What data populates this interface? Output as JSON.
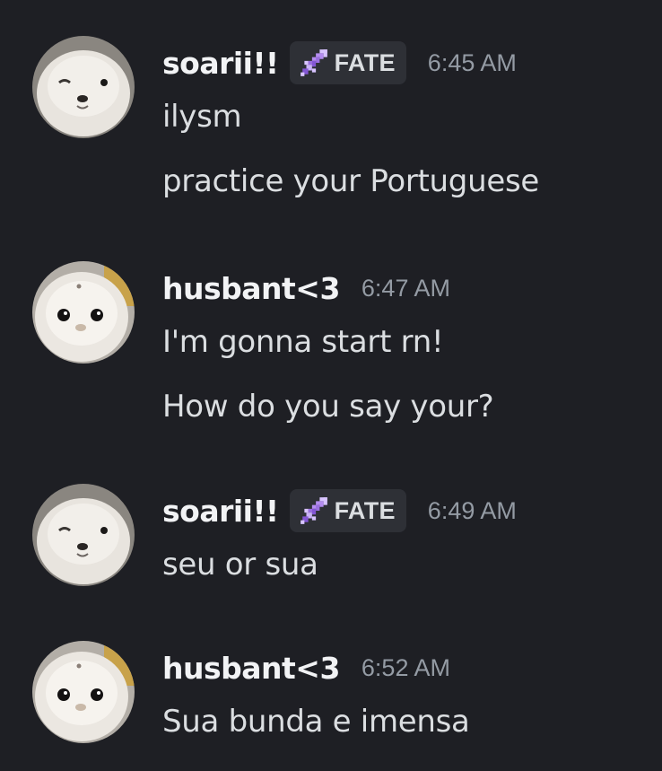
{
  "messages": [
    {
      "author": "soarii!!",
      "avatar": "seal-plush-winking-avatar",
      "role_tag": "FATE",
      "role_icon": "pixel-sword-icon",
      "time": "6:45 AM",
      "lines": [
        "ilysm",
        "practice your Portuguese"
      ]
    },
    {
      "author": "husbant<3",
      "avatar": "seal-plush-avatar",
      "time": "6:47 AM",
      "lines": [
        "I'm gonna start rn!",
        "How do you say your?"
      ]
    },
    {
      "author": "soarii!!",
      "avatar": "seal-plush-winking-avatar",
      "role_tag": "FATE",
      "role_icon": "pixel-sword-icon",
      "time": "6:49 AM",
      "lines": [
        "seu or sua"
      ]
    },
    {
      "author": "husbant<3",
      "avatar": "seal-plush-avatar",
      "time": "6:52 AM",
      "lines": [
        "Sua bunda e imensa"
      ]
    }
  ],
  "colors": {
    "background": "#1e1f24",
    "username": "#f2f3f5",
    "message_text": "#dbdee1",
    "timestamp": "#949ba4",
    "role_tag_bg": "#2e3036",
    "sword": "#b48cf0"
  }
}
